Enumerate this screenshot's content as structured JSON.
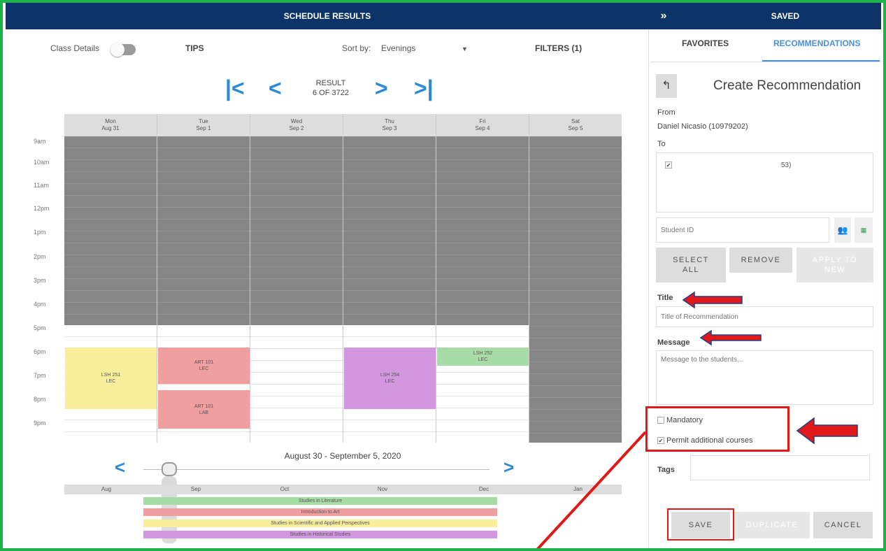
{
  "header": {
    "title": "SCHEDULE RESULTS",
    "panel_title": "SAVED"
  },
  "controls": {
    "class_details": "Class Details",
    "tips": "TIPS",
    "sort_by": "Sort by:",
    "sort_value": "Evenings",
    "filters": "FILTERS (1)"
  },
  "result": {
    "label": "RESULT",
    "position": "6 OF 3722"
  },
  "days": [
    {
      "day": "Mon",
      "date": "Aug 31"
    },
    {
      "day": "Tue",
      "date": "Sep 1"
    },
    {
      "day": "Wed",
      "date": "Sep 2"
    },
    {
      "day": "Thu",
      "date": "Sep 3"
    },
    {
      "day": "Fri",
      "date": "Sep 4"
    },
    {
      "day": "Sat",
      "date": "Sep 5"
    }
  ],
  "hours": [
    "9am",
    "10am",
    "11am",
    "12pm",
    "1pm",
    "2pm",
    "3pm",
    "4pm",
    "5pm",
    "6pm",
    "7pm",
    "8pm",
    "9pm"
  ],
  "events": [
    {
      "course": "LSH 251",
      "type": "LEC",
      "color": "#f8ee9c"
    },
    {
      "course": "ART 101",
      "type": "LEC",
      "color": "#ef9f9f"
    },
    {
      "course": "ART 101",
      "type": "LAB",
      "color": "#ef9f9f"
    },
    {
      "course": "LSH 254",
      "type": "LEC",
      "color": "#d397df"
    },
    {
      "course": "LSH 252",
      "type": "LEC",
      "color": "#a8dca6"
    }
  ],
  "range": "August 30 - September 5, 2020",
  "months": [
    "Aug",
    "Sep",
    "Oct",
    "Nov",
    "Dec",
    "Jan"
  ],
  "timeline_bars": [
    {
      "label": "Studies in Literature",
      "color": "#a8dca6"
    },
    {
      "label": "Introduction to Art",
      "color": "#ef9f9f"
    },
    {
      "label": "Studies in Scientific and Applied Perspectives",
      "color": "#f8ee9c"
    },
    {
      "label": "Studies in Historical Studies",
      "color": "#d397df"
    }
  ],
  "panel": {
    "tabs": [
      "FAVORITES",
      "RECOMMENDATIONS"
    ],
    "heading": "Create Recommendation",
    "from_label": "From",
    "from_value": "Daniel Nicasio (10979202)",
    "to_label": "To",
    "to_entry": "53)",
    "student_id_placeholder": "Student ID",
    "select_all": "SELECT ALL",
    "remove": "REMOVE",
    "apply_to_new": "APPLY TO NEW",
    "title_label": "Title",
    "title_placeholder": "Title of Recommendation",
    "message_label": "Message",
    "message_placeholder": "Message to the students...",
    "mandatory": "Mandatory",
    "permit": "Permit additional courses",
    "tags_label": "Tags",
    "save": "SAVE",
    "duplicate": "DUPLICATE",
    "cancel": "CANCEL"
  },
  "colors": {
    "header": "#0d3468",
    "accent": "#2a8ad8",
    "annotation": "#e01818",
    "frame": "#1bb34a",
    "arrow_outline": "#1f3f8a"
  }
}
